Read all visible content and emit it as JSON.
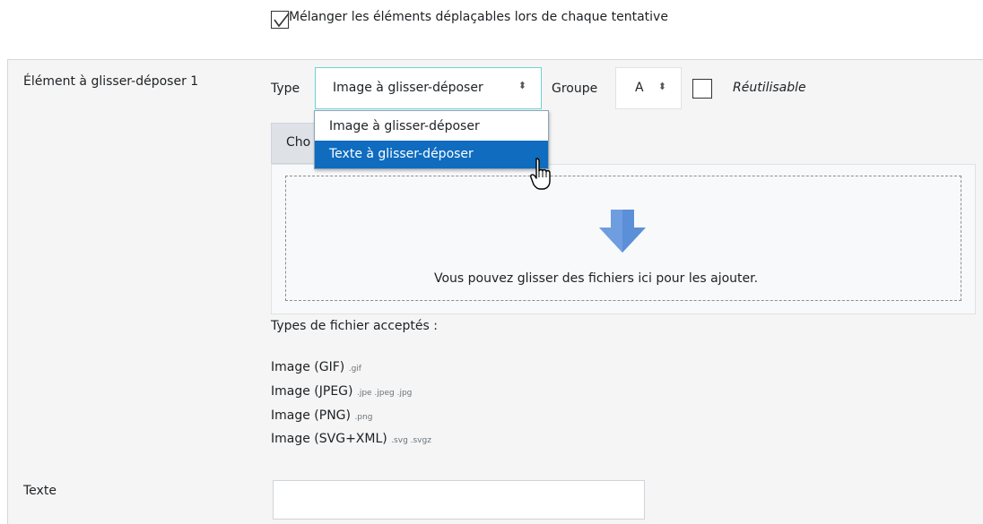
{
  "shuffle": {
    "label": "Mélanger les éléments déplaçables lors de chaque tentative",
    "checked": true
  },
  "item": {
    "label": "Élément à glisser-déposer 1",
    "type_label": "Type",
    "type_value": "Image à glisser-déposer",
    "group_label": "Groupe",
    "group_value": "A",
    "reusable_label": "Réutilisable",
    "reusable_checked": false
  },
  "type_dropdown": {
    "options": [
      "Image à glisser-déposer",
      "Texte à glisser-déposer"
    ],
    "highlighted": "Texte à glisser-déposer"
  },
  "filepicker": {
    "choose_tab_label": "Cho",
    "drop_text": "Vous pouvez glisser des fichiers ici pour les ajouter.",
    "accepted_title": "Types de fichier acceptés :",
    "accepted": [
      {
        "name": "Image (GIF)",
        "ext": ".gif"
      },
      {
        "name": "Image (JPEG)",
        "ext": ".jpe .jpeg .jpg"
      },
      {
        "name": "Image (PNG)",
        "ext": ".png"
      },
      {
        "name": "Image (SVG+XML)",
        "ext": ".svg .svgz"
      }
    ]
  },
  "text_field": {
    "label": "Texte",
    "value": ""
  },
  "colors": {
    "accent": "#0f6cbf",
    "arrow": "#5b8fd7",
    "panel": "#f5f5f5"
  }
}
